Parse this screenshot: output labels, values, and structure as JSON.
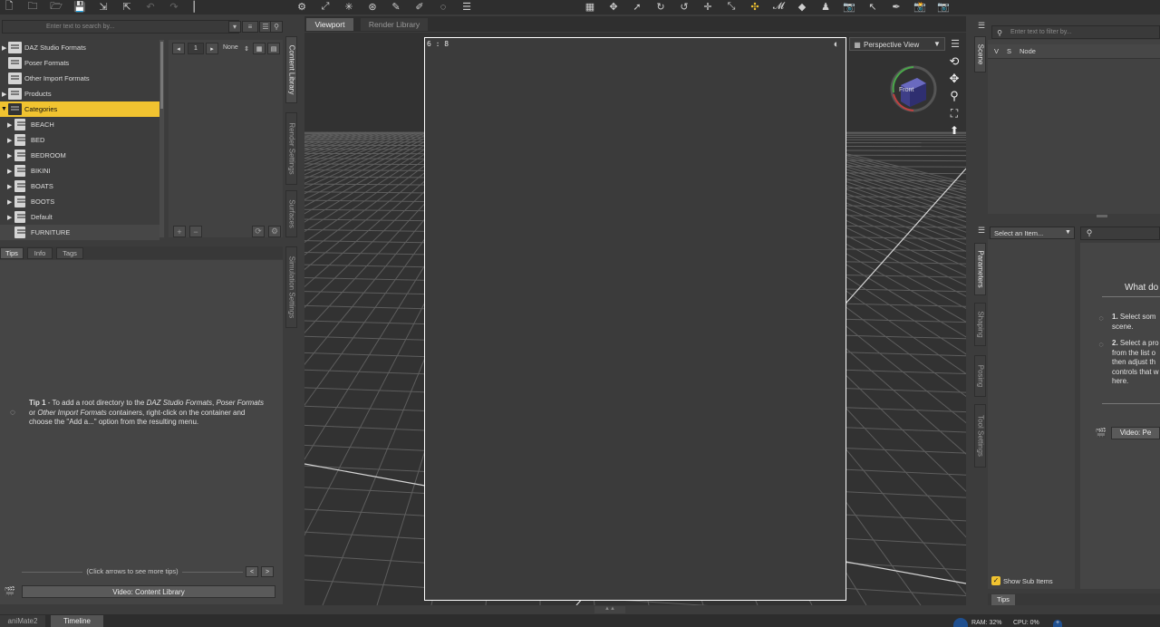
{
  "content_library": {
    "search_placeholder": "Enter text to search by...",
    "tree": [
      {
        "label": "DAZ Studio Formats",
        "expanded": false,
        "selected": false
      },
      {
        "label": "Poser Formats",
        "expanded": false,
        "selected": false
      },
      {
        "label": "Other Import Formats",
        "expanded": false,
        "selected": false
      },
      {
        "label": "Products",
        "expanded": false,
        "selected": false
      },
      {
        "label": "Categories",
        "expanded": true,
        "selected": true
      }
    ],
    "categories": [
      "BEACH",
      "BED",
      "BEDROOM",
      "BIKINI",
      "BOATS",
      "BOOTS",
      "Default",
      "FURNITURE"
    ],
    "page_number": "1",
    "sort_value": "None"
  },
  "side_tabs": {
    "left": [
      "Content Library",
      "Render Settings",
      "Surfaces",
      "Simulation Settings"
    ],
    "right_top": [
      "Scene"
    ],
    "right_bottom": [
      "Parameters",
      "Shaping",
      "Posing",
      "Tool Settings"
    ]
  },
  "tips_pane": {
    "tabs": [
      "Tips",
      "Info",
      "Tags"
    ],
    "tip_number": "Tip 1",
    "tip_text_1": " - To add a root directory to the ",
    "tip_em_1": "DAZ Studio Formats",
    "tip_text_2": ", ",
    "tip_em_2": "Poser Formats",
    "tip_text_3": " or ",
    "tip_em_3": "Other Import Formats",
    "tip_text_4": " containers, right-click on the container and choose the \"Add a...\" option from the resulting menu.",
    "nav_note": "(Click arrows to see more tips)",
    "prev": "<",
    "next": ">",
    "video_label": "Video: Content Library"
  },
  "viewport": {
    "tabs": [
      "Viewport",
      "Render Library"
    ],
    "aspect_label": "6 : 8",
    "camera": "Perspective View",
    "cube_label": "Front"
  },
  "scene": {
    "filter_placeholder": "Enter text to filter by...",
    "columns": [
      "V",
      "S",
      "Node"
    ]
  },
  "parameters": {
    "select_item": "Select an Item...",
    "show_sub_items": "Show Sub Items",
    "heading": "What do",
    "step1_num": "1.",
    "step1_text": " Select som scene.",
    "step2_num": "2.",
    "step2_text": " Select a pro from the list o then adjust th controls that w here.",
    "video_label": "Video: Pe",
    "tips_tab": "Tips"
  },
  "status_bar": {
    "tabs": [
      "aniMate2",
      "Timeline"
    ],
    "ram": "RAM: 32%",
    "cpu": "CPU: 0%"
  },
  "colors": {
    "selection": "#f1c330",
    "frame": "#ffffff",
    "background": "#3c3c3c"
  }
}
